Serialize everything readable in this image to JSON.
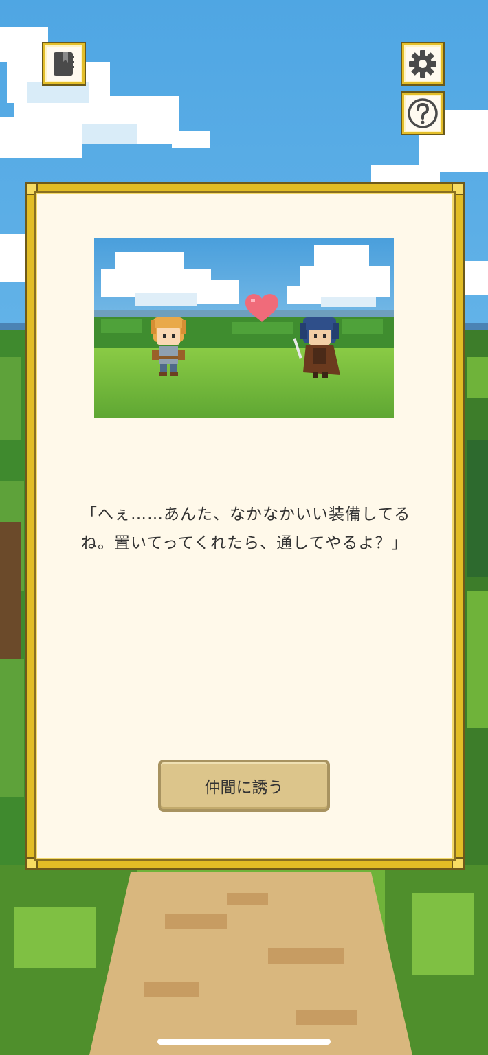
{
  "toolbar": {
    "journal_icon": "journal-icon",
    "settings_icon": "gear-icon",
    "help_icon": "question-mark-icon"
  },
  "dialog": {
    "text": "「へぇ……あんた、なかなかいい装備してるね。置いてってくれたら、通してやるよ？」",
    "invite_button_label": "仲間に誘う"
  },
  "scene": {
    "left_character": "hero-character",
    "right_character": "rogue-character",
    "heart_icon": "heart-icon"
  },
  "colors": {
    "panel_frame": "#e2bd25",
    "panel_bg": "#fff9ea",
    "button_bg": "#dcc58b",
    "sky": "#5fb0e6",
    "grass": "#6fb33a",
    "path": "#d9b77e"
  }
}
